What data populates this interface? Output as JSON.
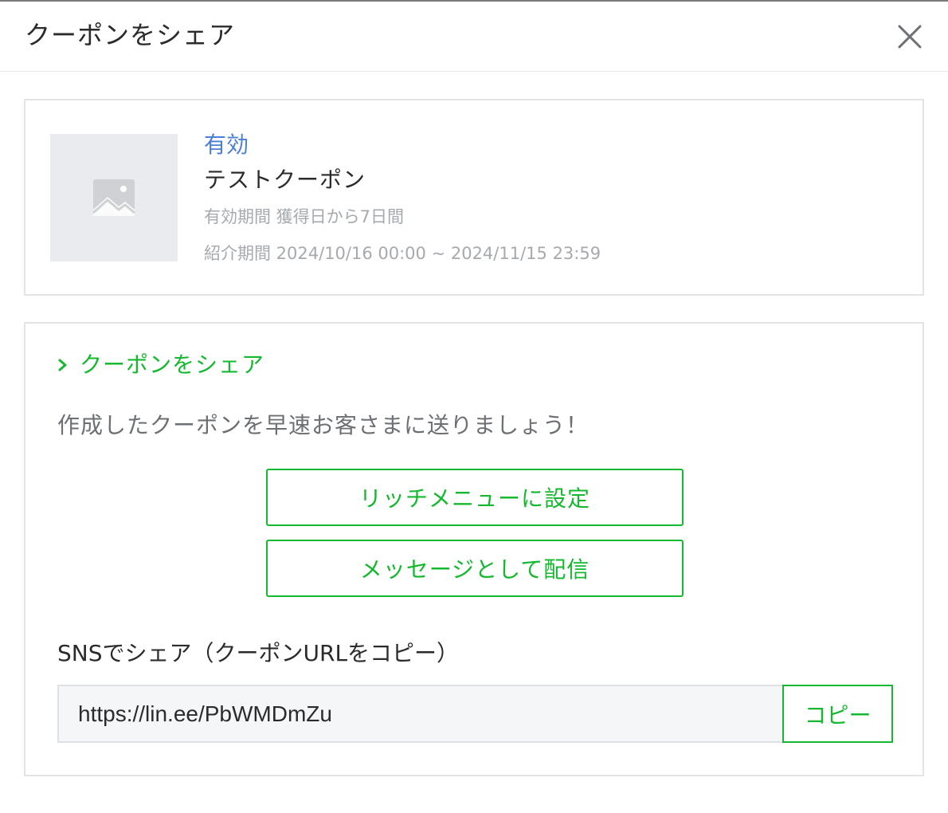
{
  "header": {
    "title": "クーポンをシェア"
  },
  "coupon": {
    "status": "有効",
    "name": "テストクーポン",
    "validity": "有効期間 獲得日から7日間",
    "intro_period": "紹介期間 2024/10/16 00:00 ~ 2024/11/15 23:59"
  },
  "share": {
    "heading": "クーポンをシェア",
    "lead": "作成したクーポンを早速お客さまに送りましょう！",
    "rich_menu_label": "リッチメニューに設定",
    "message_label": "メッセージとして配信",
    "sns_label": "SNSでシェア（クーポンURLをコピー）",
    "url_value": "https://lin.ee/PbWMDmZu",
    "copy_label": "コピー"
  },
  "icons": {
    "close": "close-icon",
    "image_placeholder": "image-placeholder-icon",
    "chevron": "chevron-right-icon"
  },
  "colors": {
    "accent_green": "#15b82f",
    "status_blue": "#4a7fd6",
    "muted_text": "#a6a9ae"
  }
}
